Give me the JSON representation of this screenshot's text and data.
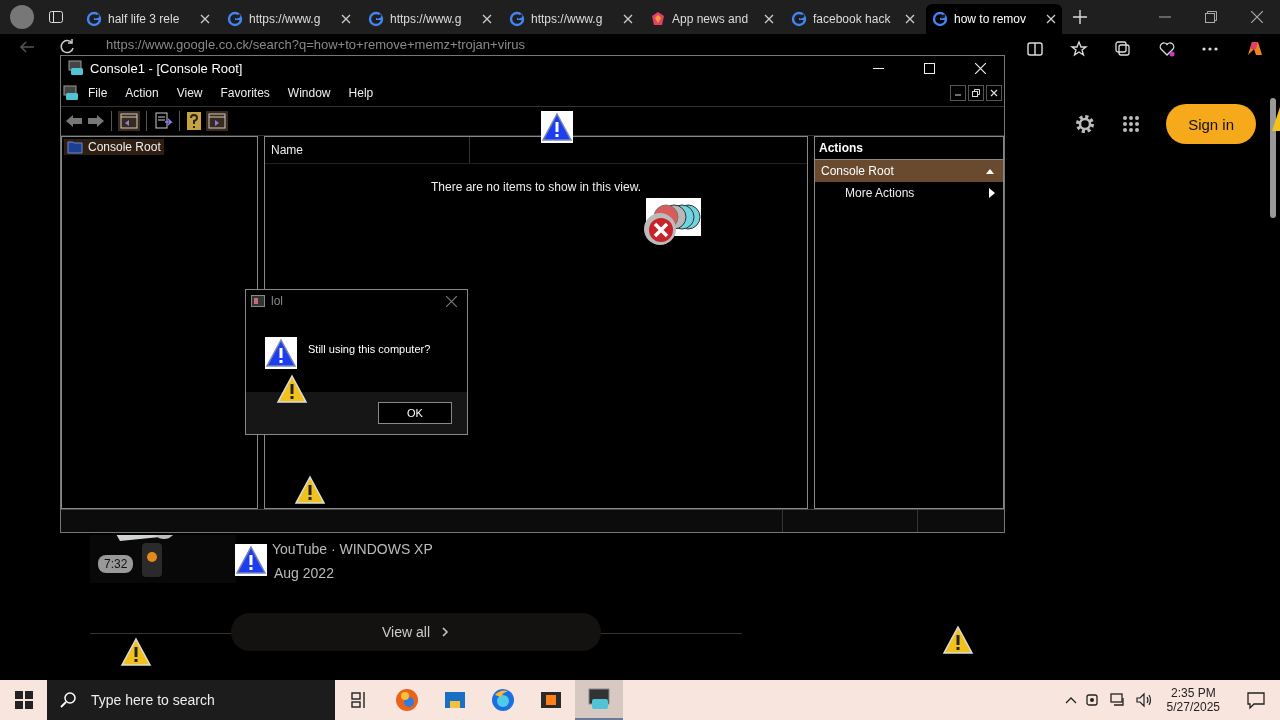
{
  "browser": {
    "tabs": [
      {
        "title": "half life 3 rele",
        "kind": "google",
        "selected": false
      },
      {
        "title": "https://www.g",
        "kind": "google",
        "selected": false
      },
      {
        "title": "https://www.g",
        "kind": "google",
        "selected": false
      },
      {
        "title": "https://www.g",
        "kind": "google",
        "selected": false
      },
      {
        "title": "App news and",
        "kind": "app",
        "selected": false
      },
      {
        "title": "facebook hack",
        "kind": "google",
        "selected": false
      },
      {
        "title": "how to remov",
        "kind": "google",
        "selected": true
      }
    ],
    "address": "https://www.google.co.ck/search?q=how+to+remove+memz+trojan+virus"
  },
  "page": {
    "sign_in": "Sign in",
    "video": {
      "duration": "7:32",
      "source": "YouTube · WINDOWS XP",
      "date": "Aug 2022"
    },
    "view_all": "View all"
  },
  "console": {
    "title": "Console1 - [Console Root]",
    "menu": [
      "File",
      "Action",
      "View",
      "Favorites",
      "Window",
      "Help"
    ],
    "tree": [
      {
        "label": "Console Root",
        "selected": true
      }
    ],
    "list": {
      "columns": [
        "Name"
      ],
      "empty_text": "There are no items to show in this view."
    },
    "actions": {
      "title": "Actions",
      "sections": [
        {
          "label": "Console Root",
          "expanded": true,
          "items": [
            "More Actions"
          ]
        }
      ]
    }
  },
  "dialog": {
    "title": "lol",
    "message": "Still using this computer?",
    "button": "OK"
  },
  "taskbar": {
    "search_placeholder": "Type here to search",
    "apps": [
      {
        "kind": "edge",
        "selected": false
      },
      {
        "kind": "folder",
        "selected": false
      },
      {
        "kind": "firefox",
        "selected": false
      },
      {
        "kind": "media",
        "selected": false
      },
      {
        "kind": "console",
        "selected": true
      }
    ],
    "time": "2:35 PM",
    "date": "5/27/2025"
  }
}
